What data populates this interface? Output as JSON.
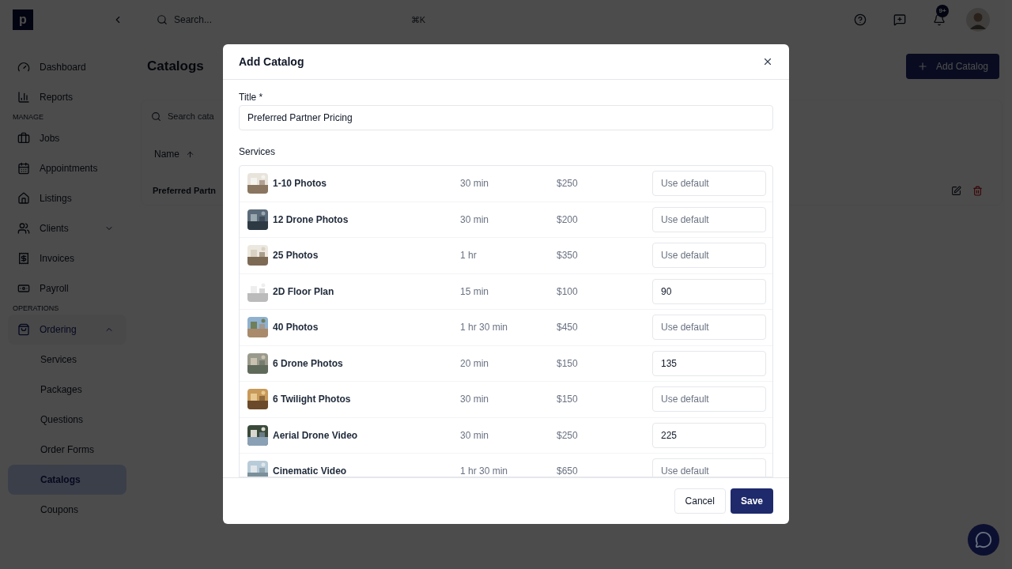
{
  "sidebar": {
    "logo": "p",
    "sections": [
      {
        "items": [
          {
            "label": "Dashboard",
            "selected": false
          },
          {
            "label": "Reports",
            "selected": false
          }
        ]
      },
      {
        "heading": "MANAGE",
        "items": [
          {
            "label": "Jobs",
            "selected": false
          },
          {
            "label": "Appointments",
            "selected": false
          },
          {
            "label": "Listings",
            "selected": false
          },
          {
            "label": "Clients",
            "selected": false,
            "expanded": false
          },
          {
            "label": "Invoices",
            "selected": false
          },
          {
            "label": "Payroll",
            "selected": false
          }
        ]
      },
      {
        "heading": "OPERATIONS",
        "items": [
          {
            "label": "Ordering",
            "selected": false,
            "expanded": true,
            "children": [
              {
                "label": "Services",
                "selected": false
              },
              {
                "label": "Packages",
                "selected": false
              },
              {
                "label": "Questions",
                "selected": false
              },
              {
                "label": "Order Forms",
                "selected": false
              },
              {
                "label": "Catalogs",
                "selected": true
              },
              {
                "label": "Coupons",
                "selected": false
              }
            ]
          }
        ]
      }
    ]
  },
  "topbar": {
    "search_placeholder": "Search...",
    "shortcut": "⌘K",
    "notification_badge": "9+"
  },
  "page": {
    "title": "Catalogs",
    "primary_button": "Add Catalog",
    "search_placeholder": "Search cata",
    "table": {
      "columns": [
        "Name"
      ],
      "rows": [
        {
          "name": "Preferred Partn"
        }
      ]
    }
  },
  "dialog": {
    "title": "Add Catalog",
    "title_label": "Title *",
    "title_value": "Preferred Partner Pricing",
    "services_label": "Services",
    "services": [
      {
        "name": "1-10 Photos",
        "duration": "30 min",
        "price": "$250",
        "placeholder": "Use default"
      },
      {
        "name": "12 Drone Photos",
        "duration": "30 min",
        "price": "$200",
        "placeholder": "Use default"
      },
      {
        "name": "25 Photos",
        "duration": "1 hr",
        "price": "$350",
        "placeholder": "Use default"
      },
      {
        "name": "2D Floor Plan",
        "duration": "15 min",
        "price": "$100",
        "value": "90"
      },
      {
        "name": "40 Photos",
        "duration": "1 hr 30 min",
        "price": "$450",
        "placeholder": "Use default"
      },
      {
        "name": "6 Drone Photos",
        "duration": "20 min",
        "price": "$150",
        "value": "135"
      },
      {
        "name": "6 Twilight Photos",
        "duration": "30 min",
        "price": "$150",
        "placeholder": "Use default"
      },
      {
        "name": "Aerial Drone Video",
        "duration": "30 min",
        "price": "$250",
        "value": "225"
      },
      {
        "name": "Cinematic Video",
        "duration": "1 hr 30 min",
        "price": "$650",
        "placeholder": "Use default"
      }
    ],
    "buttons": [
      {
        "label": "Cancel",
        "kind": "secondary"
      },
      {
        "label": "Save",
        "kind": "primary"
      }
    ]
  }
}
